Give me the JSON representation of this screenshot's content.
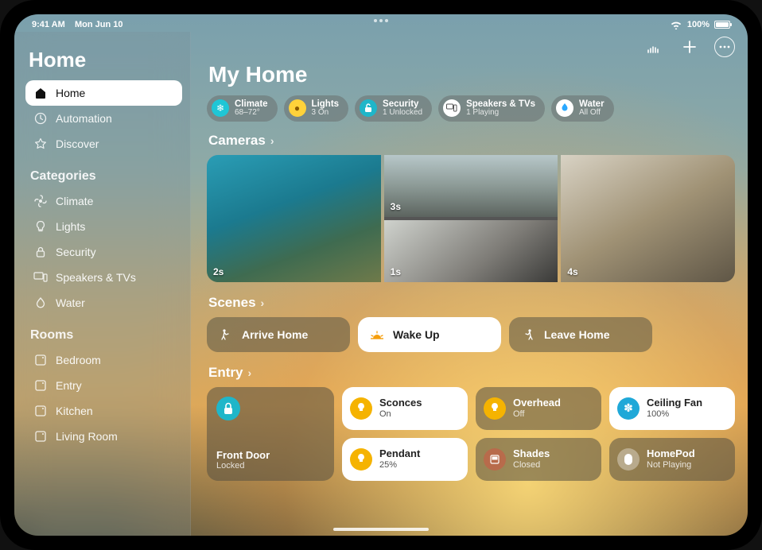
{
  "status": {
    "time": "9:41 AM",
    "date": "Mon Jun 10",
    "battery": "100%"
  },
  "sidebar": {
    "title": "Home",
    "nav": [
      {
        "id": "home",
        "label": "Home",
        "selected": true
      },
      {
        "id": "automation",
        "label": "Automation",
        "selected": false
      },
      {
        "id": "discover",
        "label": "Discover",
        "selected": false
      }
    ],
    "categories_header": "Categories",
    "categories": [
      {
        "id": "climate",
        "label": "Climate"
      },
      {
        "id": "lights",
        "label": "Lights"
      },
      {
        "id": "security",
        "label": "Security"
      },
      {
        "id": "speakers-tvs",
        "label": "Speakers & TVs"
      },
      {
        "id": "water",
        "label": "Water"
      }
    ],
    "rooms_header": "Rooms",
    "rooms": [
      {
        "id": "bedroom",
        "label": "Bedroom"
      },
      {
        "id": "entry",
        "label": "Entry"
      },
      {
        "id": "kitchen",
        "label": "Kitchen"
      },
      {
        "id": "living-room",
        "label": "Living Room"
      }
    ]
  },
  "main": {
    "title": "My Home",
    "chips": [
      {
        "id": "climate",
        "title": "Climate",
        "subtitle": "68–72°",
        "color": "#1fc6d6"
      },
      {
        "id": "lights",
        "title": "Lights",
        "subtitle": "3 On",
        "color": "#ffd23a"
      },
      {
        "id": "security",
        "title": "Security",
        "subtitle": "1 Unlocked",
        "color": "#1fb6c9"
      },
      {
        "id": "speakers-tvs",
        "title": "Speakers & TVs",
        "subtitle": "1 Playing",
        "color": "#ffffff"
      },
      {
        "id": "water",
        "title": "Water",
        "subtitle": "All Off",
        "color": "#2aa8ff"
      }
    ],
    "cameras": {
      "header": "Cameras",
      "items": [
        {
          "id": "pool",
          "timestamp": "2s"
        },
        {
          "id": "driveway",
          "timestamp": "3s"
        },
        {
          "id": "garage",
          "timestamp": "1s"
        },
        {
          "id": "living",
          "timestamp": "4s"
        }
      ]
    },
    "scenes": {
      "header": "Scenes",
      "items": [
        {
          "id": "arrive-home",
          "label": "Arrive Home",
          "active": false
        },
        {
          "id": "wake-up",
          "label": "Wake Up",
          "active": true
        },
        {
          "id": "leave-home",
          "label": "Leave Home",
          "active": false
        }
      ]
    },
    "entry": {
      "header": "Entry",
      "tiles": [
        {
          "id": "front-door",
          "name": "Front Door",
          "status": "Locked",
          "icon": "lock",
          "color": "#1fb6c9",
          "big": true,
          "on": false
        },
        {
          "id": "sconces",
          "name": "Sconces",
          "status": "On",
          "icon": "bulb",
          "color": "#f5b301",
          "on": true
        },
        {
          "id": "overhead",
          "name": "Overhead",
          "status": "Off",
          "icon": "bulb",
          "color": "#f5b301",
          "on": false
        },
        {
          "id": "ceiling-fan",
          "name": "Ceiling Fan",
          "status": "100%",
          "icon": "fan",
          "color": "#1fa8d8",
          "on": true
        },
        {
          "id": "pendant",
          "name": "Pendant",
          "status": "25%",
          "icon": "bulb",
          "color": "#f5b301",
          "on": true
        },
        {
          "id": "shades",
          "name": "Shades",
          "status": "Closed",
          "icon": "shades",
          "color": "#b86b4b",
          "on": false
        },
        {
          "id": "homepod",
          "name": "HomePod",
          "status": "Not Playing",
          "icon": "homepod",
          "color": "#ffffff",
          "on": false
        }
      ]
    }
  }
}
